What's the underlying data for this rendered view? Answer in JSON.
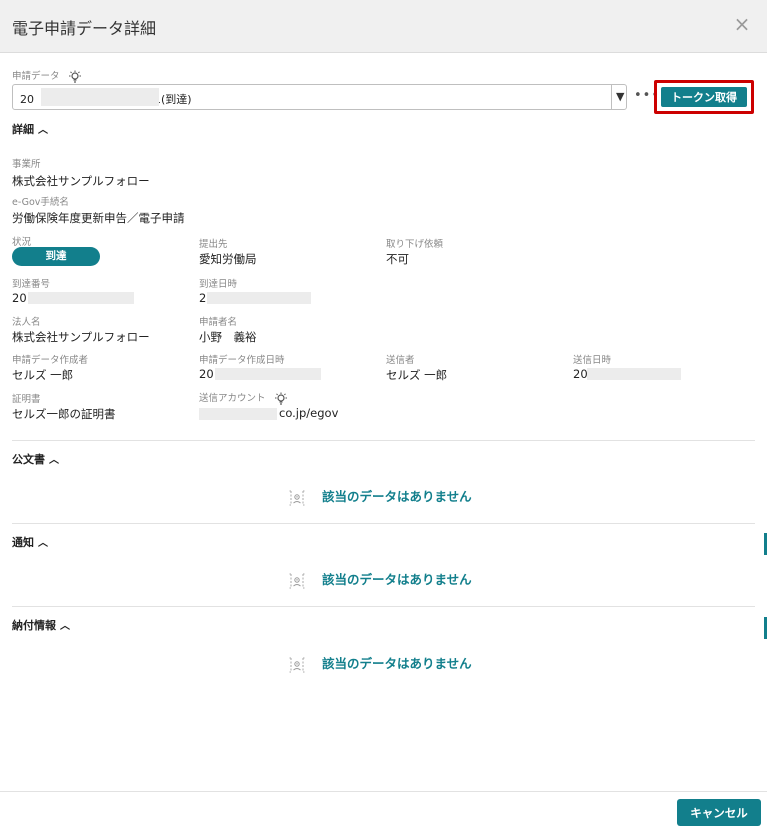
{
  "dialog": {
    "title": "電子申請データ詳細",
    "close_icon": "×"
  },
  "application": {
    "label": "申請データ",
    "selected_prefix": "20",
    "selected_suffix": "1(到達)",
    "more_icon": "•••",
    "arrow_icon": "▼",
    "token_button": "トークン取得"
  },
  "details": {
    "section_title": "詳細",
    "office": {
      "label": "事業所",
      "value": "株式会社サンプルフォロー"
    },
    "procedure": {
      "label": "e-Gov手続名",
      "value": "労働保険年度更新申告／電子申請"
    },
    "status": {
      "label": "状況",
      "value": "到達"
    },
    "destination": {
      "label": "提出先",
      "value": "愛知労働局"
    },
    "withdraw": {
      "label": "取り下げ依頼",
      "value": "不可"
    },
    "arrival_no": {
      "label": "到達番号",
      "value": "20"
    },
    "arrival_date": {
      "label": "到達日時",
      "value": "2"
    },
    "corporation": {
      "label": "法人名",
      "value": "株式会社サンプルフォロー"
    },
    "applicant": {
      "label": "申請者名",
      "value": "小野　義裕"
    },
    "creator": {
      "label": "申請データ作成者",
      "value": "セルズ 一郎"
    },
    "created_at": {
      "label": "申請データ作成日時",
      "value": "20"
    },
    "sender": {
      "label": "送信者",
      "value": "セルズ 一郎"
    },
    "sent_at": {
      "label": "送信日時",
      "value": "20"
    },
    "certificate": {
      "label": "証明書",
      "value": "セルズ一郎の証明書"
    },
    "account": {
      "label": "送信アカウント",
      "value": "co.jp/egov"
    }
  },
  "sections": {
    "official_docs": "公文書",
    "notices": "通知",
    "payment": "納付情報",
    "no_data": "該当のデータはありません"
  },
  "footer": {
    "cancel_button": "キャンセル"
  },
  "colors": {
    "accent": "#127f8c",
    "highlight": "#cc0000"
  }
}
